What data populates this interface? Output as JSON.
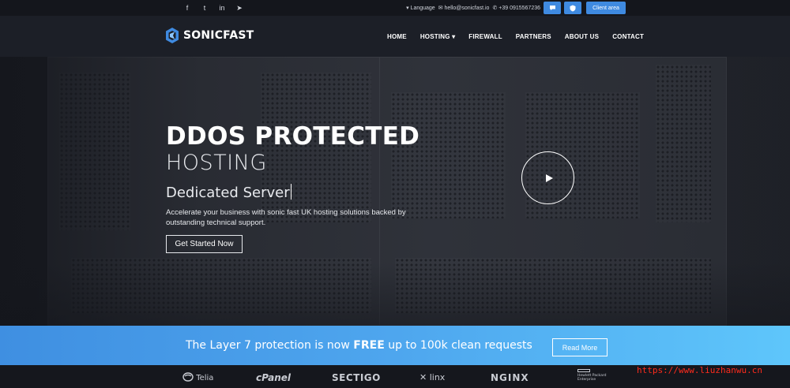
{
  "topbar": {
    "socials": [
      {
        "icon": "facebook-icon",
        "glyph": "f"
      },
      {
        "icon": "twitter-icon",
        "glyph": "t"
      },
      {
        "icon": "linkedin-icon",
        "glyph": "in"
      },
      {
        "icon": "telegram-icon",
        "glyph": "➤"
      }
    ],
    "language": "▾ Language",
    "email": "✉ hello@sonicfast.io",
    "phone": "✆ +39 0915567236",
    "client_area": "Client area"
  },
  "nav": {
    "brand": "SONICFAST",
    "items": [
      "HOME",
      "HOSTING ▾",
      "FIREWALL",
      "PARTNERS",
      "ABOUT US",
      "CONTACT"
    ]
  },
  "hero": {
    "title": "DDOS PROTECTED",
    "subtitle": "HOSTING",
    "typed": "Dedicated Server",
    "description": "Accelerate your business with sonic fast UK hosting solutions backed by outstanding technical support.",
    "cta": "Get Started Now"
  },
  "promo": {
    "text_before": "The Layer 7 protection is now ",
    "text_bold": "FREE",
    "text_after": " up to 100k clean requests",
    "button": "Read More"
  },
  "partners": [
    "Telia",
    "cPanel",
    "SECTIGO",
    "linx",
    "NGINX",
    "Hewlett Packard Enterprise"
  ],
  "watermark": "https://www.liuzhanwu.cn",
  "colors": {
    "accent": "#3f8ae0",
    "promo_start": "#3f8fe1",
    "promo_end": "#5ec6fb",
    "watermark": "#ff2b1c"
  }
}
